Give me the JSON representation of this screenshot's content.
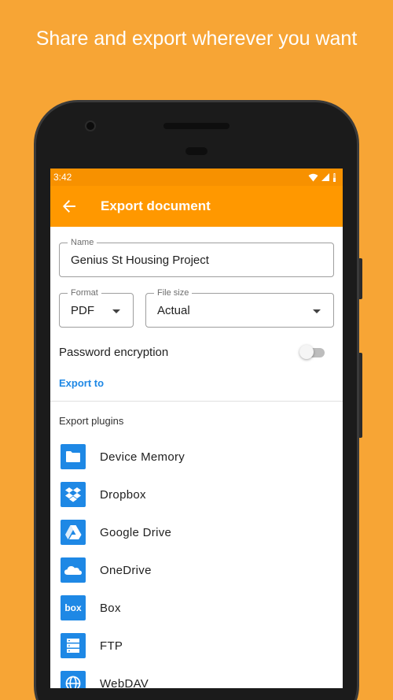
{
  "headline": "Share and export wherever you want",
  "status_bar": {
    "time": "3:42"
  },
  "app_bar": {
    "title": "Export document"
  },
  "name_field": {
    "label": "Name",
    "value": "Genius St Housing Project"
  },
  "format_field": {
    "label": "Format",
    "value": "PDF"
  },
  "size_field": {
    "label": "File size",
    "value": "Actual"
  },
  "password": {
    "label": "Password encryption",
    "enabled": false
  },
  "export_to": {
    "label": "Export to"
  },
  "plugins": {
    "title": "Export plugins",
    "items": [
      {
        "label": "Device Memory",
        "icon": "folder-icon"
      },
      {
        "label": "Dropbox",
        "icon": "dropbox-icon"
      },
      {
        "label": "Google Drive",
        "icon": "google-drive-icon"
      },
      {
        "label": "OneDrive",
        "icon": "onedrive-icon"
      },
      {
        "label": "Box",
        "icon": "box-icon",
        "icon_text": "box"
      },
      {
        "label": "FTP",
        "icon": "ftp-icon"
      },
      {
        "label": "WebDAV",
        "icon": "webdav-icon"
      }
    ]
  },
  "colors": {
    "background": "#F7A535",
    "app_bar": "#FF9800",
    "status_bar": "#F79100",
    "accent": "#1E88E5"
  }
}
